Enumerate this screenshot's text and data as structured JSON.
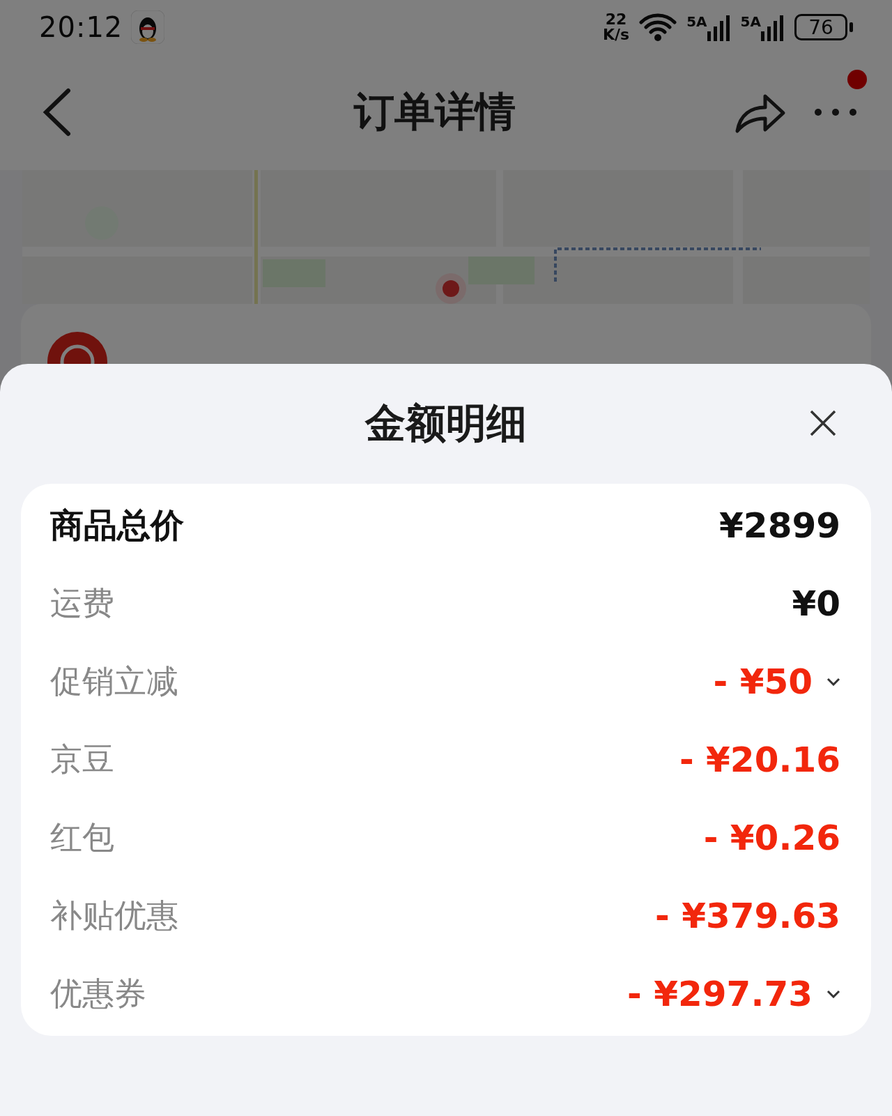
{
  "status_bar": {
    "time": "20:12",
    "speed_value": "22",
    "speed_unit": "K/s",
    "signals": [
      {
        "label": "5A"
      },
      {
        "label": "5A"
      }
    ],
    "battery": "76"
  },
  "header": {
    "title": "订单详情",
    "notification_dot": true
  },
  "sheet": {
    "title": "金额明细",
    "rows": [
      {
        "kind": "total",
        "label": "商品总价",
        "value": "¥2899",
        "expandable": false
      },
      {
        "kind": "fee",
        "label": "运费",
        "value": "¥0",
        "expandable": false
      },
      {
        "kind": "discount",
        "label": "促销立减",
        "value": "- ¥50",
        "expandable": true
      },
      {
        "kind": "discount",
        "label": "京豆",
        "value": "- ¥20.16",
        "expandable": false
      },
      {
        "kind": "discount",
        "label": "红包",
        "value": "- ¥0.26",
        "expandable": false
      },
      {
        "kind": "discount",
        "label": "补贴优惠",
        "value": "- ¥379.63",
        "expandable": false
      },
      {
        "kind": "discount",
        "label": "优惠券",
        "value": "- ¥297.73",
        "expandable": true
      }
    ]
  }
}
